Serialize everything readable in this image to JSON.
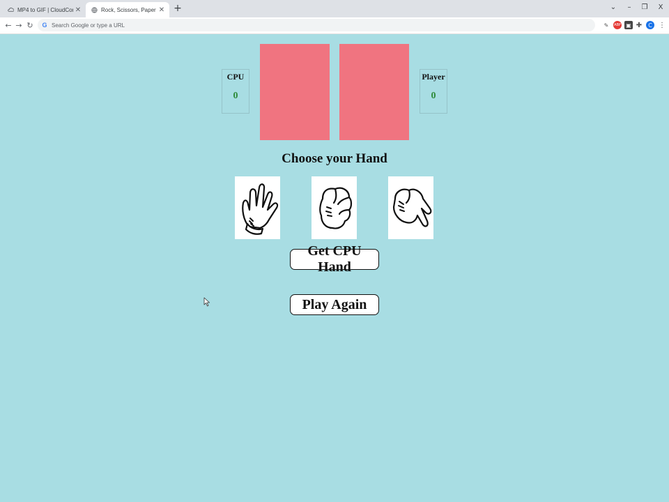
{
  "browser": {
    "tabs": [
      {
        "title": "MP4 to GIF | CloudConvert",
        "active": false
      },
      {
        "title": "Rock, Scissors, Paper",
        "active": true
      }
    ],
    "new_tab_icon": "plus-icon",
    "address_placeholder": "Search Google or type a URL",
    "profile_initial": "C",
    "extension_badge": "ABP"
  },
  "game": {
    "cpu": {
      "label": "CPU",
      "score": "0"
    },
    "player": {
      "label": "Player",
      "score": "0"
    },
    "panel_color": "#f07480",
    "heading": "Choose your Hand",
    "choices": [
      {
        "name": "paper",
        "icon": "open-hand-paper-icon"
      },
      {
        "name": "rock",
        "icon": "fist-rock-icon"
      },
      {
        "name": "scissors",
        "icon": "two-fingers-scissors-icon"
      }
    ],
    "buttons": {
      "get_cpu_hand": "Get CPU Hand",
      "play_again": "Play Again"
    }
  },
  "colors": {
    "page_background": "#a8dde3",
    "score_green": "#2e8b3a"
  }
}
